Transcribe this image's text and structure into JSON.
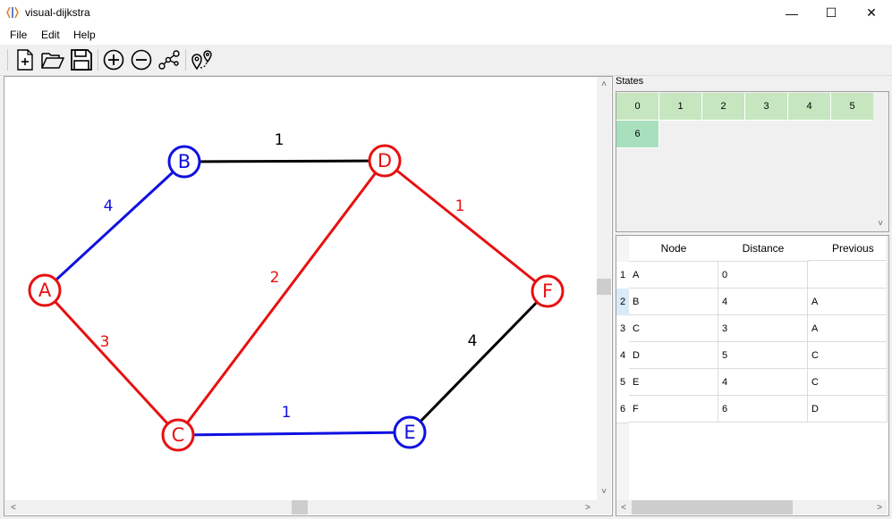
{
  "window": {
    "title": "visual-dijkstra",
    "minimize_glyph": "—",
    "maximize_glyph": "☐",
    "close_glyph": "✕"
  },
  "menu": [
    {
      "label": "File"
    },
    {
      "label": "Edit"
    },
    {
      "label": "Help"
    }
  ],
  "toolbar": {
    "icons": [
      "new-file-icon",
      "open-folder-icon",
      "save-icon",
      "add-node-icon",
      "remove-node-icon",
      "graph-icon",
      "route-icon"
    ]
  },
  "graph": {
    "nodes": [
      {
        "id": "A",
        "label": "A",
        "color": "#e81010"
      },
      {
        "id": "B",
        "label": "B",
        "color": "#1010e0"
      },
      {
        "id": "C",
        "label": "C",
        "color": "#e81010"
      },
      {
        "id": "D",
        "label": "D",
        "color": "#e81010"
      },
      {
        "id": "E",
        "label": "E",
        "color": "#1010e0"
      },
      {
        "id": "F",
        "label": "F",
        "color": "#e81010"
      }
    ],
    "edges": [
      {
        "from": "A",
        "to": "B",
        "weight": "4",
        "color": "#1010e0"
      },
      {
        "from": "B",
        "to": "D",
        "weight": "1",
        "color": "#000000"
      },
      {
        "from": "A",
        "to": "C",
        "weight": "3",
        "color": "#e81010"
      },
      {
        "from": "C",
        "to": "D",
        "weight": "2",
        "color": "#e81010"
      },
      {
        "from": "D",
        "to": "F",
        "weight": "1",
        "color": "#e81010"
      },
      {
        "from": "C",
        "to": "E",
        "weight": "1",
        "color": "#1010e0"
      },
      {
        "from": "E",
        "to": "F",
        "weight": "4",
        "color": "#000000"
      }
    ]
  },
  "states": {
    "label": "States",
    "items": [
      "0",
      "1",
      "2",
      "3",
      "4",
      "5",
      "6"
    ],
    "active": "6"
  },
  "table": {
    "headers": [
      "Node",
      "Distance",
      "Previous"
    ],
    "rows": [
      {
        "num": "1",
        "node": "A",
        "distance": "0",
        "previous": ""
      },
      {
        "num": "2",
        "node": "B",
        "distance": "4",
        "previous": "A"
      },
      {
        "num": "3",
        "node": "C",
        "distance": "3",
        "previous": "A"
      },
      {
        "num": "4",
        "node": "D",
        "distance": "5",
        "previous": "C"
      },
      {
        "num": "5",
        "node": "E",
        "distance": "4",
        "previous": "C"
      },
      {
        "num": "6",
        "node": "F",
        "distance": "6",
        "previous": "D"
      }
    ]
  },
  "scroll_arrows": {
    "up": "˄",
    "down": "˅",
    "left": "<",
    "right": ">"
  }
}
